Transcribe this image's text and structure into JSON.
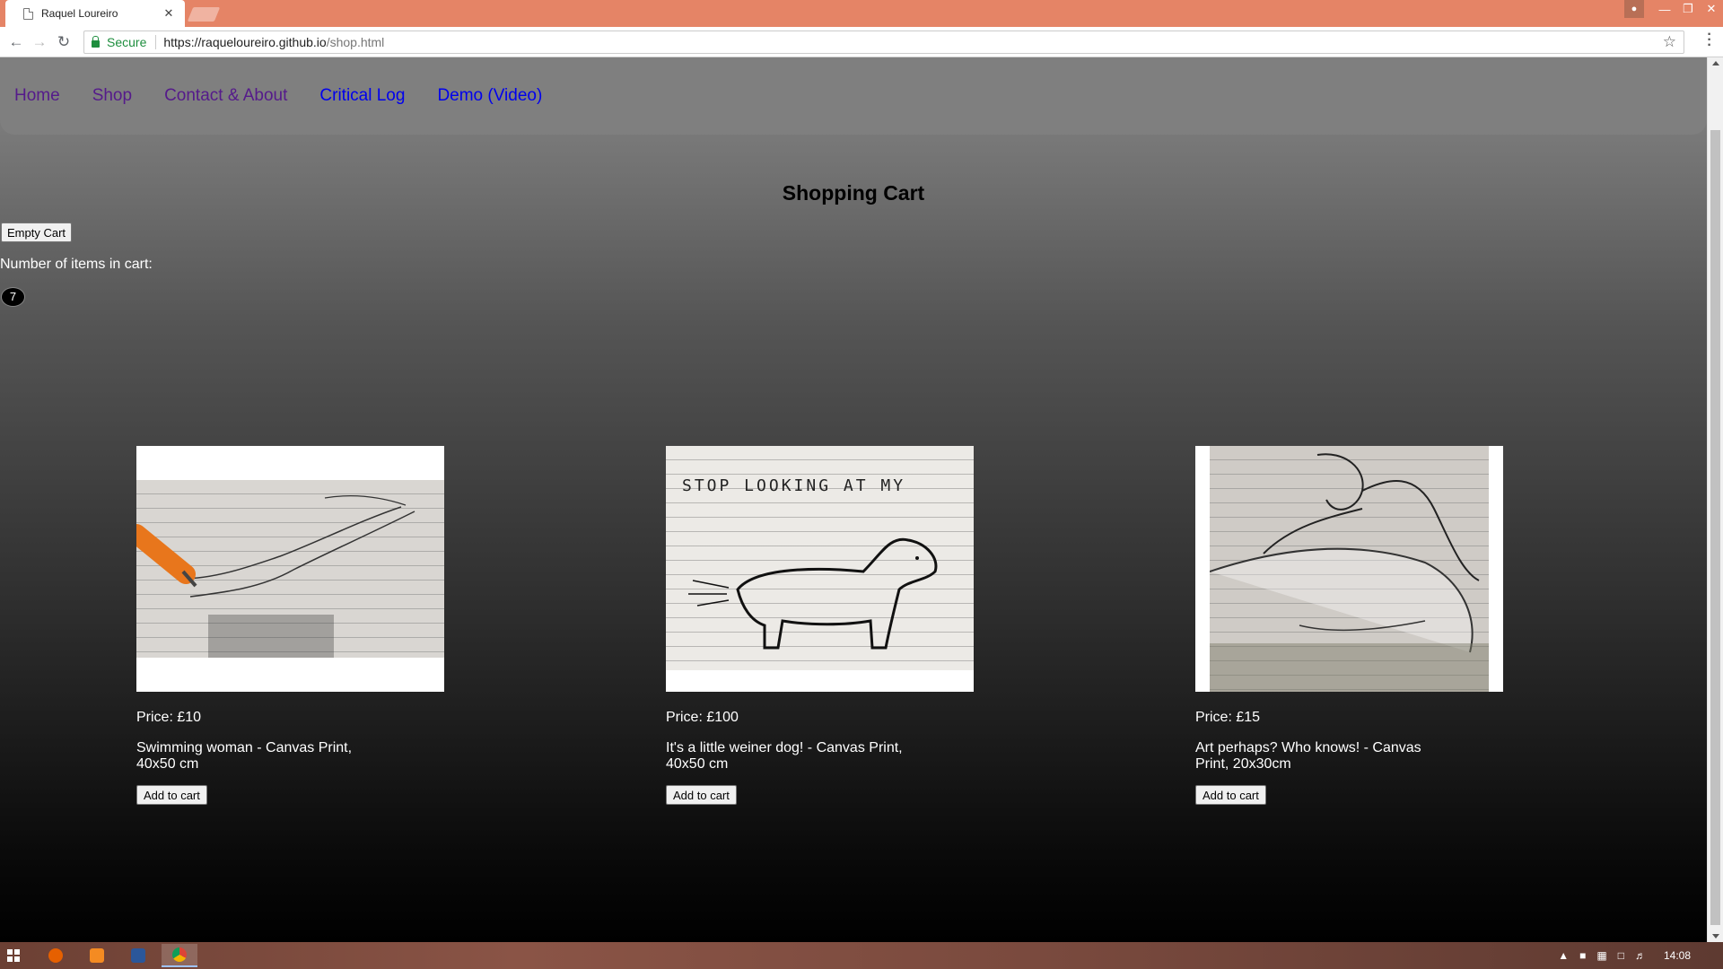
{
  "browser": {
    "tab_title": "Raquel Loureiro",
    "tab_close": "✕",
    "secure_label": "Secure",
    "url_host": "https://raqueloureiro.github.io",
    "url_path": "/shop.html"
  },
  "nav": {
    "items": [
      {
        "label": "Home"
      },
      {
        "label": "Shop"
      },
      {
        "label": "Contact & About"
      },
      {
        "label": "Critical Log"
      },
      {
        "label": "Demo (Video)"
      }
    ]
  },
  "cart": {
    "title": "Shopping Cart",
    "empty_button": "Empty Cart",
    "count_label": "Number of items in cart:",
    "count": "7"
  },
  "products": [
    {
      "price": "Price: £10",
      "title": "Swimming woman - Canvas Print, 40x50 cm",
      "button": "Add to cart"
    },
    {
      "price": "Price: £100",
      "title": "It's a little weiner dog! - Canvas Print, 40x50 cm",
      "button": "Add to cart",
      "art_text": "STOP LOOKING AT MY"
    },
    {
      "price": "Price: £15",
      "title": "Art perhaps? Who knows! - Canvas Print, 20x30cm",
      "button": "Add to cart"
    }
  ],
  "taskbar": {
    "clock": "14:08"
  },
  "colors": {
    "titlebar": "#e58466",
    "link_visited": "#551a8b",
    "link_new": "#0000ee",
    "secure_green": "#1e8e3e"
  }
}
